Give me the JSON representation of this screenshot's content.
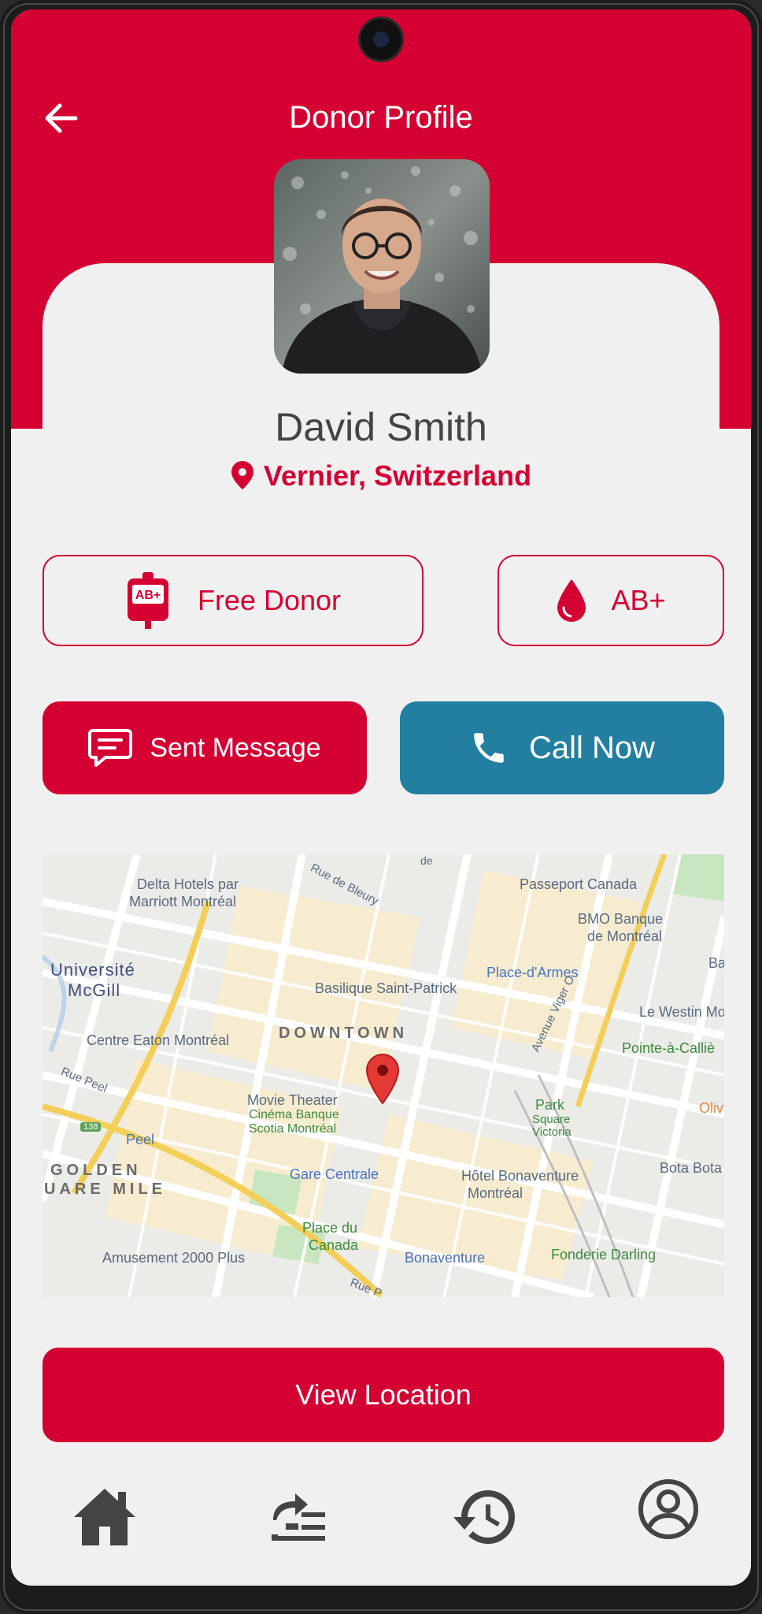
{
  "header": {
    "title": "Donor Profile"
  },
  "profile": {
    "name": "David Smith",
    "location": "Vernier, Switzerland"
  },
  "badges": {
    "donor_type": "Free Donor",
    "blood_group": "AB+",
    "bag_label": "AB+"
  },
  "actions": {
    "message": "Sent Message",
    "call": "Call Now"
  },
  "map": {
    "labels": {
      "l1": "Delta Hotels par",
      "l2": "Marriott Montréal",
      "l3": "Passeport Canada",
      "l4": "BMO Banque",
      "l5": "de Montréal",
      "l6": "Université",
      "l7": "McGill",
      "l8": "Place-d'Armes",
      "l9": "Basilique Saint-Patrick",
      "l10": "Le Westin Mont",
      "l11": "DOWNTOWN",
      "l12": "Centre Eaton Montréal",
      "l13": "Pointe-à-Calliè",
      "l14": "Movie Theater",
      "l15": "Cinéma Banque",
      "l16": "Scotia Montréal",
      "l17": "Park",
      "l18": "Square",
      "l19": "Victoria",
      "l20": "Oliv",
      "l21": "Peel",
      "l22": "GOLDEN",
      "l23": "UARE MILE",
      "l24": "Gare Centrale",
      "l25": "Hôtel Bonaventure",
      "l26": "Montréal",
      "l27": "Bota Bota",
      "l28": "Place du",
      "l29": "Canada",
      "l30": "Amusement 2000 Plus",
      "l31": "Bonaventure",
      "l32": "Fonderie Darling",
      "l33": "Rue Peel",
      "l34": "Rue de Bleury",
      "l35": "Avenue Viger O",
      "l36": "Rue P",
      "l37": "138",
      "l38": "Ba",
      "l39": "de"
    }
  },
  "view_location": "View Location",
  "colors": {
    "primary": "#d50032",
    "call": "#227fa0",
    "nav_icon": "#444444"
  },
  "nav": {
    "icons": [
      "home-icon",
      "requests-icon",
      "history-icon",
      "profile-icon"
    ]
  }
}
